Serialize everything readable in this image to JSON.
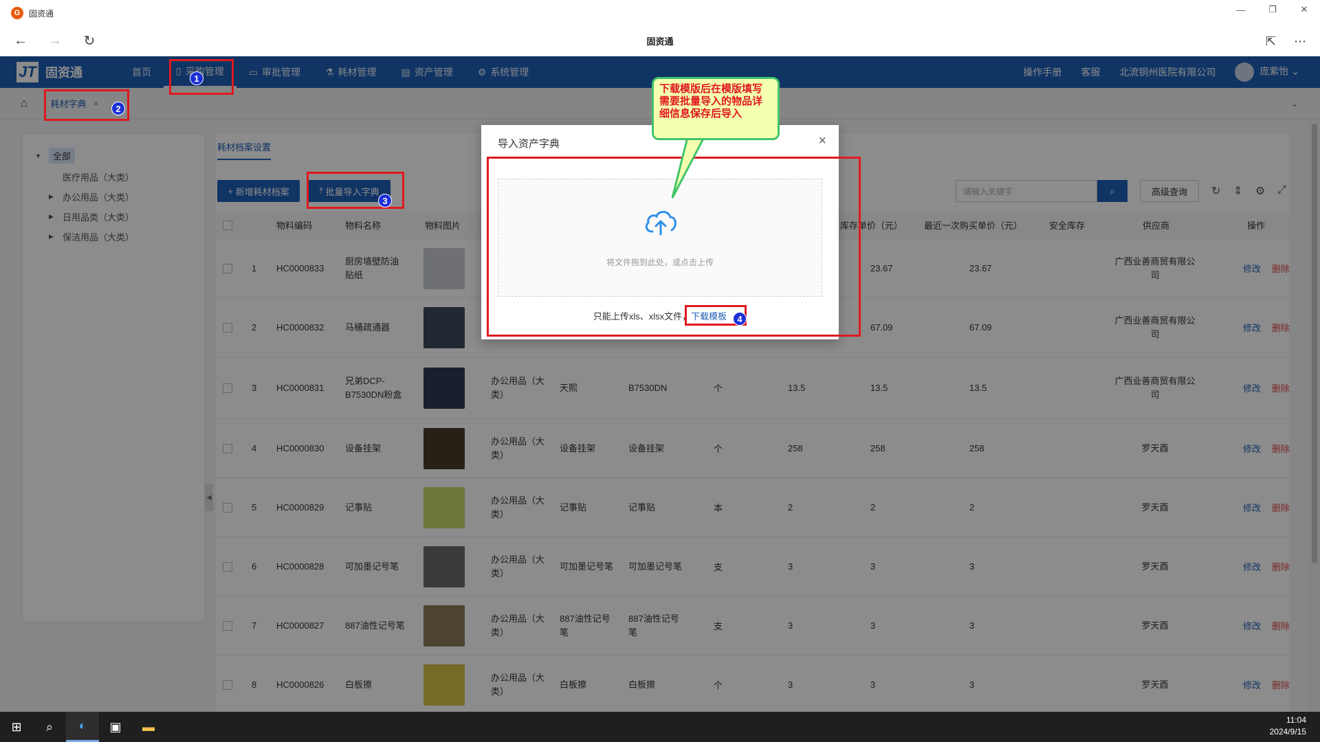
{
  "window": {
    "title": "固资通",
    "page_heading": "固资通"
  },
  "app": {
    "brand_mark": "JT",
    "brand_name": "固资通",
    "menu": [
      {
        "label": "首页",
        "icon": "home-icon"
      },
      {
        "label": "采购管理",
        "icon": "doc-icon"
      },
      {
        "label": "审批管理",
        "icon": "monitor-icon"
      },
      {
        "label": "耗材管理",
        "icon": "flask-icon"
      },
      {
        "label": "资产管理",
        "icon": "calendar-icon"
      },
      {
        "label": "系统管理",
        "icon": "gear-icon"
      }
    ],
    "header_right": {
      "manual": "操作手册",
      "service": "客服",
      "org": "北流铜州医院有限公司",
      "user": "庞紫怡"
    }
  },
  "tabs": {
    "active_tab": "耗材字典"
  },
  "sidebar": {
    "root": "全部",
    "items": [
      "医疗用品（大类）",
      "办公用品（大类）",
      "日用品类（大类）",
      "保洁用品（大类）"
    ]
  },
  "content": {
    "tab": "耗材档案设置",
    "add_button": "新增耗材档案",
    "import_button": "批量导入字典",
    "search_placeholder": "请输入关键字",
    "advanced_button": "高级查询"
  },
  "table": {
    "columns": [
      "物料编码",
      "物料名称",
      "物料图片",
      "库存单价（元）",
      "最近一次购买单价（元）",
      "安全库存",
      "供应商",
      "操作"
    ],
    "action_edit": "修改",
    "action_delete": "删除",
    "rows": [
      {
        "no": "1",
        "code": "HC0000833",
        "name": "厨房墙壁防油贴纸",
        "category": "",
        "brand": "",
        "model": "",
        "unit": "",
        "ref_price": "",
        "stock_price": "23.67",
        "last_price": "23.67",
        "supplier": "广西业善商贸有限公司"
      },
      {
        "no": "2",
        "code": "HC0000832",
        "name": "马桶疏通器",
        "category": "",
        "brand": "",
        "model": "",
        "unit": "",
        "ref_price": "",
        "stock_price": "67.09",
        "last_price": "67.09",
        "supplier": "广西业善商贸有限公司"
      },
      {
        "no": "3",
        "code": "HC0000831",
        "name": "兄弟DCP-B7530DN粉盒",
        "category": "办公用品（大类）",
        "brand": "天熙",
        "model": "B7530DN",
        "unit": "个",
        "ref_price": "13.5",
        "stock_price": "13.5",
        "last_price": "13.5",
        "supplier": "广西业善商贸有限公司"
      },
      {
        "no": "4",
        "code": "HC0000830",
        "name": "设备挂架",
        "category": "办公用品（大类）",
        "brand": "设备挂架",
        "model": "设备挂架",
        "unit": "个",
        "ref_price": "258",
        "stock_price": "258",
        "last_price": "258",
        "supplier": "罗天酉"
      },
      {
        "no": "5",
        "code": "HC0000829",
        "name": "记事贴",
        "category": "办公用品（大类）",
        "brand": "记事贴",
        "model": "记事贴",
        "unit": "本",
        "ref_price": "2",
        "stock_price": "2",
        "last_price": "2",
        "supplier": "罗天酉"
      },
      {
        "no": "6",
        "code": "HC0000828",
        "name": "可加墨记号笔",
        "category": "办公用品（大类）",
        "brand": "可加墨记号笔",
        "model": "可加墨记号笔",
        "unit": "支",
        "ref_price": "3",
        "stock_price": "3",
        "last_price": "3",
        "supplier": "罗天酉"
      },
      {
        "no": "7",
        "code": "HC0000827",
        "name": "887油性记号笔",
        "category": "办公用品（大类）",
        "brand": "887油性记号笔",
        "model": "887油性记号笔",
        "unit": "支",
        "ref_price": "3",
        "stock_price": "3",
        "last_price": "3",
        "supplier": "罗天酉"
      },
      {
        "no": "8",
        "code": "HC0000826",
        "name": "白板擦",
        "category": "办公用品（大类）",
        "brand": "白板擦",
        "model": "白板擦",
        "unit": "个",
        "ref_price": "3",
        "stock_price": "3",
        "last_price": "3",
        "supplier": "罗天酉"
      }
    ]
  },
  "dialog": {
    "title": "导入资产字典",
    "drop_text": "将文件拖到此处，或点击上传",
    "note": "只能上传xls、xlsx文件，",
    "download_link": "下载模板"
  },
  "annotations": {
    "callout": "下载模版后在模版填写需要批量导入的物品详细信息保存后导入",
    "markers": [
      "1",
      "2",
      "3",
      "4"
    ]
  },
  "taskbar": {
    "time": "11:04",
    "date": "2024/9/15"
  },
  "colors": {
    "primary": "#1e5fb6",
    "annotation_red": "#e0191f",
    "callout_bg": "#f4ffb0",
    "marker_blue": "#1b2fd8"
  }
}
